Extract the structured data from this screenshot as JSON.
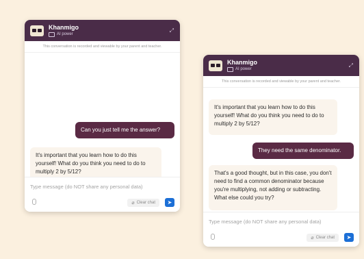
{
  "chats": [
    {
      "title": "Khanmigo",
      "subtitle": "AI power",
      "notice": "This conversation is recorded and viewable by your parent and teacher.",
      "messages": [
        {
          "role": "user",
          "text": "Can you just tell me the answer?"
        },
        {
          "role": "bot",
          "text": "It's important that you learn how to do this yourself! What do you think you need to do to multiply 2 by 5/12?"
        }
      ],
      "input_placeholder": "Type message (do NOT share any personal data)",
      "clear_label": "Clear chat"
    },
    {
      "title": "Khanmigo",
      "subtitle": "AI power",
      "notice": "This conversation is recorded and viewable by your parent and teacher.",
      "messages": [
        {
          "role": "bot",
          "text": "It's important that you learn how to do this yourself! What do you think you need to do to multiply 2 by 5/12?"
        },
        {
          "role": "user",
          "text": "They need the same denominator."
        },
        {
          "role": "bot",
          "text": "That's a good thought, but in this case, you don't need to find a common denominator because you're multiplying, not adding or subtracting. What else could you try?"
        }
      ],
      "input_placeholder": "Type message (do NOT share any personal data)",
      "clear_label": "Clear chat"
    }
  ],
  "colors": {
    "header": "#4a2c48",
    "user_bubble": "#5a2a44",
    "bot_bubble": "#faf4ec",
    "send_button": "#1c6fd6",
    "background": "#fbf0df"
  },
  "icons": [
    "khanmigo-avatar-icon",
    "ai-chip-icon",
    "expand-icon",
    "microphone-icon",
    "eraser-icon",
    "send-icon"
  ]
}
